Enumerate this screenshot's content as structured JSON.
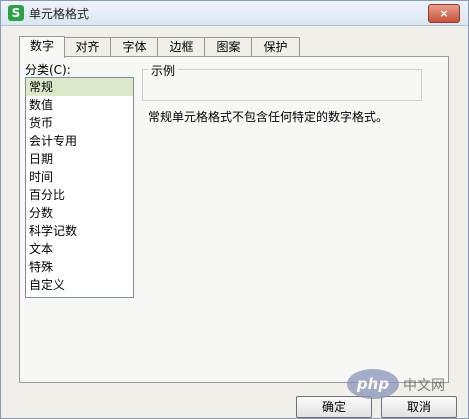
{
  "window": {
    "icon_text": "S",
    "title": "单元格格式",
    "close_glyph": "×"
  },
  "tabs": [
    {
      "label": "数字",
      "active": true
    },
    {
      "label": "对齐"
    },
    {
      "label": "字体"
    },
    {
      "label": "边框"
    },
    {
      "label": "图案"
    },
    {
      "label": "保护"
    }
  ],
  "category": {
    "label": "分类(C):",
    "items": [
      "常规",
      "数值",
      "货币",
      "会计专用",
      "日期",
      "时间",
      "百分比",
      "分数",
      "科学记数",
      "文本",
      "特殊",
      "自定义"
    ],
    "selected": "常规"
  },
  "sample": {
    "label": "示例",
    "value": ""
  },
  "description": "常规单元格格式不包含任何特定的数字格式。",
  "buttons": {
    "ok": "确定",
    "cancel": "取消"
  },
  "watermark": {
    "logo": "php",
    "text": "中文网"
  }
}
